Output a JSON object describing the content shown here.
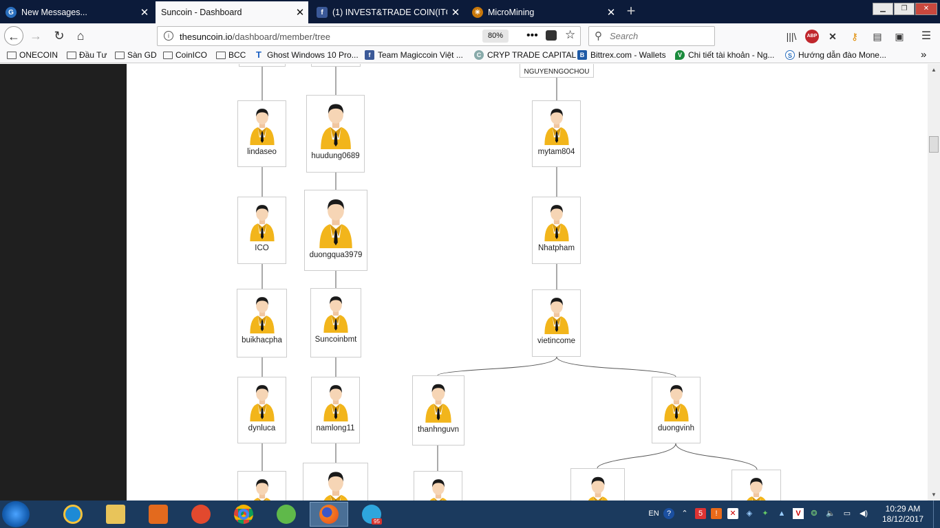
{
  "tabs": [
    {
      "label": "New Messages...",
      "icon": "messages-icon",
      "active": false
    },
    {
      "label": "Suncoin - Dashboard",
      "icon": "",
      "active": true
    },
    {
      "label": "(1) INVEST&TRADE COIN(ITC...",
      "icon": "facebook-icon",
      "active": false
    },
    {
      "label": "MicroMining",
      "icon": "micromining-icon",
      "active": false
    }
  ],
  "nav": {
    "url_domain": "thesuncoin.io",
    "url_path": "/dashboard/member/tree",
    "zoom": "80%",
    "search_placeholder": "Search"
  },
  "bookmarks": [
    {
      "label": "ONECOIN",
      "type": "folder"
    },
    {
      "label": "Đầu Tư",
      "type": "folder"
    },
    {
      "label": "Sàn GD",
      "type": "folder"
    },
    {
      "label": "CoinICO",
      "type": "folder"
    },
    {
      "label": "BCC",
      "type": "folder"
    },
    {
      "label": "Ghost Windows 10 Pro...",
      "type": "link",
      "icon": "T"
    },
    {
      "label": "Team Magiccoin Việt ...",
      "type": "link",
      "icon": "f"
    },
    {
      "label": "CRYP TRADE CAPITAL",
      "type": "link",
      "icon": "C"
    },
    {
      "label": "Bittrex.com - Wallets",
      "type": "link",
      "icon": "B"
    },
    {
      "label": "Chi tiết tài khoản - Ng...",
      "type": "link",
      "icon": "V"
    },
    {
      "label": "Hướng dẫn đào Mone...",
      "type": "link",
      "icon": "S"
    }
  ],
  "tree": {
    "top_partial_label": "NGUYENNGOCHOU",
    "nodes": [
      {
        "id": "lindaseo",
        "label": "lindaseo"
      },
      {
        "id": "ico",
        "label": "ICO"
      },
      {
        "id": "buikhacpha",
        "label": "buikhacpha"
      },
      {
        "id": "dynluca",
        "label": "dynluca"
      },
      {
        "id": "huudung0689",
        "label": "huudung0689"
      },
      {
        "id": "duongqua3979",
        "label": "duongqua3979"
      },
      {
        "id": "suncoinbmt",
        "label": "Suncoinbmt"
      },
      {
        "id": "namlong11",
        "label": "namlong11"
      },
      {
        "id": "mytam804",
        "label": "mytam804"
      },
      {
        "id": "nhatpham",
        "label": "Nhatpham"
      },
      {
        "id": "vietincome",
        "label": "vietincome"
      },
      {
        "id": "thanhnguvn",
        "label": "thanhnguvn"
      },
      {
        "id": "duongvinh",
        "label": "duongvinh"
      }
    ]
  },
  "taskbar": {
    "apps": [
      "internet-explorer",
      "file-explorer",
      "media-player",
      "opera",
      "chrome",
      "coccoc",
      "firefox",
      "telegram"
    ],
    "telegram_badge": "95",
    "lang": "EN",
    "time": "10:29 AM",
    "date": "18/12/2017"
  },
  "colors": {
    "tabbar": "#0c1b3a",
    "suit": "#f2b51b",
    "taskbar": "#1b3a5e"
  }
}
